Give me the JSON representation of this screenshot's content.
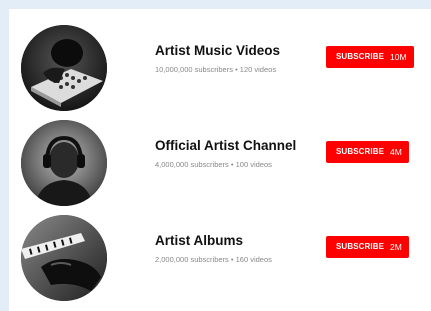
{
  "channels": [
    {
      "name": "Artist Music Videos",
      "subscribers": "10,000,000 subscribers",
      "separator": "•",
      "videos": "120 videos",
      "subscribe_label": "SUBSCRIBE",
      "subscribe_count": "10M",
      "thumbnail": "dj-mixer-icon"
    },
    {
      "name": "Official Artist Channel",
      "subscribers": "4,000,000 subscribers",
      "separator": "•",
      "videos": "100 videos",
      "subscribe_label": "SUBSCRIBE",
      "subscribe_count": "4M",
      "thumbnail": "headphones-person-icon"
    },
    {
      "name": "Artist Albums",
      "subscribers": "2,000,000 subscribers",
      "separator": "•",
      "videos": "160 videos",
      "subscribe_label": "SUBSCRIBE",
      "subscribe_count": "2M",
      "thumbnail": "piano-hands-icon"
    }
  ],
  "colors": {
    "background": "#e3edf8",
    "panel": "#ffffff",
    "subscribe_button": "#ff0000",
    "meta_text": "#888888"
  }
}
